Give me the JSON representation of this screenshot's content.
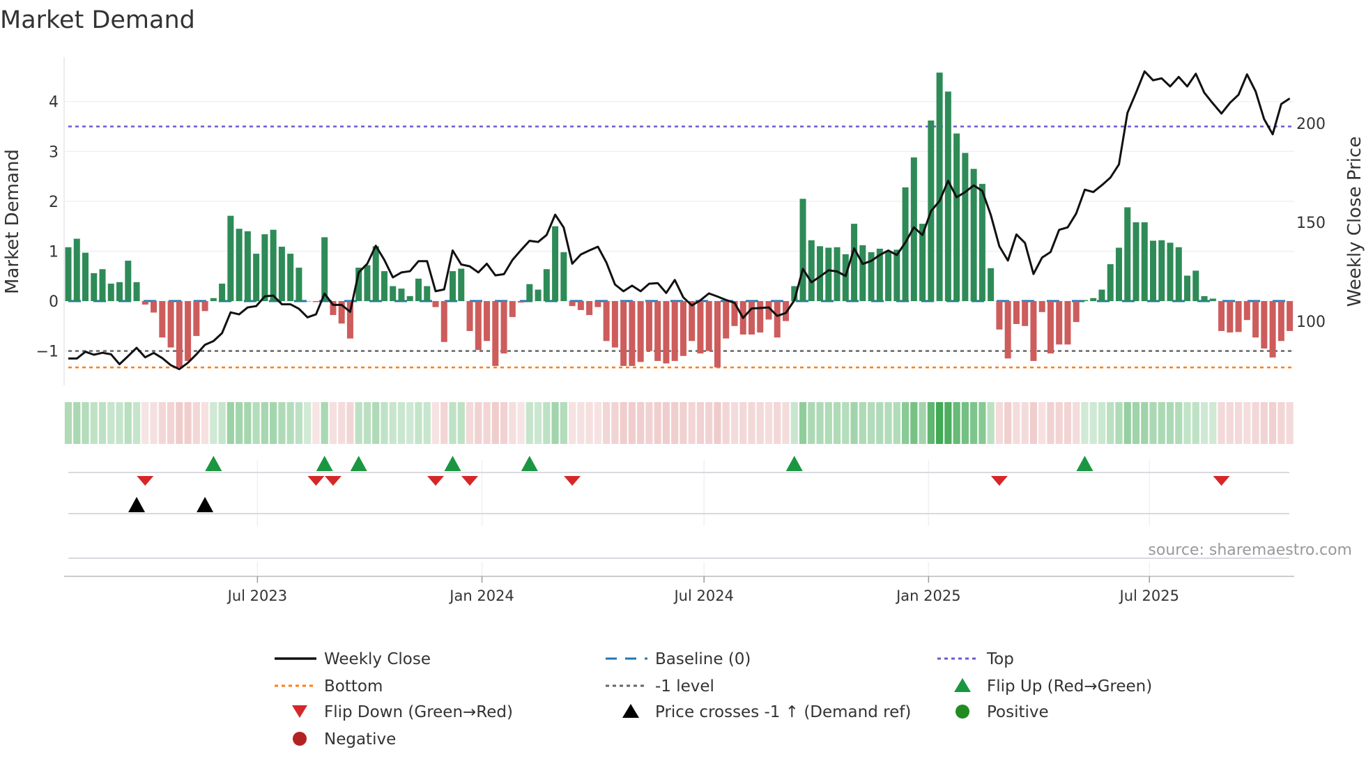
{
  "chart_data": {
    "type": "bar",
    "title": "Market Demand",
    "ylabel": "Market Demand",
    "y2label": "Weekly Close Price",
    "ylim": [
      -1.69,
      4.89
    ],
    "y2lim": [
      67.6,
      233.5
    ],
    "yticks": [
      -1,
      0,
      1,
      2,
      3,
      4
    ],
    "ytick_labels": [
      "−1",
      "0",
      "1",
      "2",
      "3",
      "4"
    ],
    "y2ticks": [
      100,
      150,
      200
    ],
    "y2tick_labels": [
      "100",
      "150",
      "200"
    ],
    "x_start": "2023-01-27",
    "x_interval_days": 7,
    "xticks": [
      {
        "date": "2023-07-01",
        "label": "Jul 2023"
      },
      {
        "date": "2024-01-01",
        "label": "Jan 2024"
      },
      {
        "date": "2024-07-01",
        "label": "Jul 2024"
      },
      {
        "date": "2025-01-01",
        "label": "Jan 2025"
      },
      {
        "date": "2025-07-01",
        "label": "Jul 2025"
      }
    ],
    "reference_lines": {
      "top": 3.5,
      "baseline": 0,
      "minus_one": -1,
      "bottom": -1.33
    },
    "demand": [
      1.08,
      1.25,
      0.97,
      0.56,
      0.64,
      0.35,
      0.38,
      0.81,
      0.38,
      -0.07,
      -0.23,
      -0.73,
      -0.93,
      -1.33,
      -1.2,
      -0.7,
      -0.2,
      0.06,
      0.35,
      1.71,
      1.45,
      1.4,
      0.95,
      1.34,
      1.43,
      1.09,
      0.95,
      0.67,
      0.0,
      -0.02,
      1.28,
      -0.28,
      -0.45,
      -0.75,
      0.67,
      0.72,
      1.1,
      0.6,
      0.3,
      0.25,
      0.1,
      0.45,
      0.3,
      -0.12,
      -0.82,
      0.6,
      0.65,
      -0.6,
      -0.98,
      -0.8,
      -1.3,
      -1.05,
      -0.32,
      -0.03,
      0.34,
      0.23,
      0.64,
      1.5,
      0.98,
      -0.1,
      -0.18,
      -0.28,
      -0.12,
      -0.8,
      -0.93,
      -1.3,
      -1.3,
      -1.22,
      -1.0,
      -1.2,
      -1.25,
      -1.2,
      -1.1,
      -0.8,
      -1.05,
      -1.0,
      -1.33,
      -0.75,
      -0.5,
      -0.67,
      -0.67,
      -0.63,
      -0.37,
      -0.73,
      -0.4,
      0.3,
      2.05,
      1.22,
      1.1,
      1.07,
      1.08,
      0.94,
      1.55,
      1.12,
      0.98,
      1.05,
      1.0,
      1.03,
      2.28,
      2.88,
      1.55,
      3.62,
      4.58,
      4.2,
      3.36,
      2.97,
      2.65,
      2.35,
      0.66,
      -0.57,
      -1.15,
      -0.46,
      -0.5,
      -1.2,
      -0.22,
      -1.05,
      -0.87,
      -0.87,
      -0.42,
      0.02,
      0.06,
      0.23,
      0.74,
      1.07,
      1.88,
      1.58,
      1.58,
      1.21,
      1.22,
      1.17,
      1.08,
      0.51,
      0.61,
      0.1,
      0.05,
      -0.6,
      -0.63,
      -0.62,
      -0.38,
      -0.73,
      -0.95,
      -1.13,
      -0.8,
      -0.6
    ],
    "weekly_close": [
      81.2,
      81.2,
      84.6,
      83.1,
      84.1,
      83.3,
      78.3,
      82.4,
      86.6,
      81.8,
      84.0,
      81.4,
      77.8,
      75.8,
      79.0,
      83.3,
      88.1,
      90.0,
      94.0,
      104.5,
      103.5,
      107.0,
      107.7,
      112.6,
      113.0,
      108.6,
      108.6,
      106.3,
      102.0,
      103.5,
      114.0,
      108.3,
      108.3,
      104.8,
      124.7,
      129.1,
      138.2,
      131.0,
      122.2,
      124.7,
      125.3,
      130.4,
      130.4,
      115.2,
      116.1,
      135.8,
      128.7,
      127.8,
      124.7,
      129.1,
      123.2,
      123.8,
      131.0,
      136.0,
      140.7,
      140.1,
      143.6,
      153.9,
      147.4,
      129.1,
      133.8,
      135.8,
      137.7,
      129.7,
      118.6,
      115.2,
      118.0,
      115.2,
      119.0,
      119.3,
      114.3,
      120.9,
      112.1,
      108.0,
      110.6,
      114.1,
      112.5,
      110.8,
      109.3,
      101.7,
      106.5,
      106.7,
      107.0,
      102.7,
      104.2,
      110.6,
      126.5,
      119.7,
      122.6,
      125.8,
      125.2,
      122.9,
      136.9,
      129.0,
      130.5,
      133.5,
      135.8,
      133.5,
      139.8,
      147.5,
      143.6,
      155.7,
      160.8,
      171.0,
      162.7,
      165.3,
      168.7,
      165.9,
      153.8,
      137.9,
      130.7,
      143.9,
      139.6,
      123.9,
      132.2,
      135.0,
      146.2,
      147.5,
      154.5,
      166.5,
      165.3,
      168.8,
      172.6,
      179.3,
      205.3,
      215.5,
      226.3,
      221.8,
      222.8,
      218.7,
      223.5,
      218.7,
      225.1,
      215.5,
      210.1,
      205.0,
      210.4,
      214.5,
      224.8,
      216.2,
      202.2,
      194.5,
      209.8,
      212.6
    ],
    "flip_up_weeks": [
      17,
      30,
      34,
      45,
      54,
      85,
      119
    ],
    "flip_down_weeks": [
      9,
      29,
      31,
      43,
      47,
      59,
      109,
      135
    ],
    "price_cross_weeks": [
      8,
      16
    ],
    "legend": [
      {
        "label": "Weekly Close",
        "kind": "line",
        "color": "#111111"
      },
      {
        "label": "Baseline (0)",
        "kind": "dash",
        "color": "#1f77b4"
      },
      {
        "label": "Top",
        "kind": "dot",
        "color": "#6a5acd"
      },
      {
        "label": "Bottom",
        "kind": "dot",
        "color": "#ff7f0e"
      },
      {
        "label": "-1 level",
        "kind": "dot",
        "color": "#666666"
      },
      {
        "label": "Flip Up (Red→Green)",
        "kind": "tri-up",
        "color": "#1a9641"
      },
      {
        "label": "Flip Down (Green→Red)",
        "kind": "tri-down",
        "color": "#d62728"
      },
      {
        "label": "Price crosses -1 ↑ (Demand ref)",
        "kind": "tri-up",
        "color": "#000000"
      },
      {
        "label": "Positive",
        "kind": "dot-marker",
        "color": "#228b22"
      },
      {
        "label": "Negative",
        "kind": "dot-marker",
        "color": "#b22222"
      }
    ],
    "legend_placement": "bottom",
    "colors": {
      "positive_bar": "#2e8b57",
      "negative_bar": "#cd5c5c",
      "grid": "#eef0f4"
    }
  },
  "source": "source: sharemaestro.com"
}
